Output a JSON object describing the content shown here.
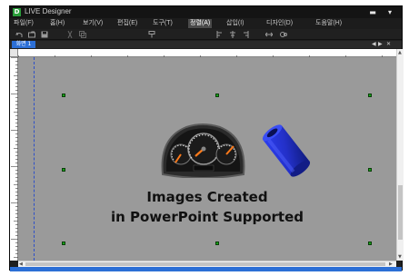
{
  "window": {
    "title": "LIVE Designer",
    "minimize_glyph": "▬",
    "menu_glyph": "▾"
  },
  "menu": {
    "items": [
      "파일(F)",
      "홈(H)",
      "보기(V)",
      "편집(E)",
      "도구(T)",
      "정렬(A)",
      "삽입(I)",
      "디자인(D)",
      "도움말(H)"
    ]
  },
  "tabs": [
    {
      "label": "화면 1"
    }
  ],
  "canvas": {
    "caption_line1": "Images Created",
    "caption_line2": "in PowerPoint Supported"
  },
  "colors": {
    "canvas_bg": "#9a9a9a",
    "tab_accent": "#2c6fd6",
    "handle": "#17a317",
    "guide": "#2d4fc8"
  },
  "icons": [
    "app-logo-icon",
    "minimize-icon",
    "dropdown-icon",
    "gauge-dashboard-image",
    "blue-cylinder-image"
  ]
}
